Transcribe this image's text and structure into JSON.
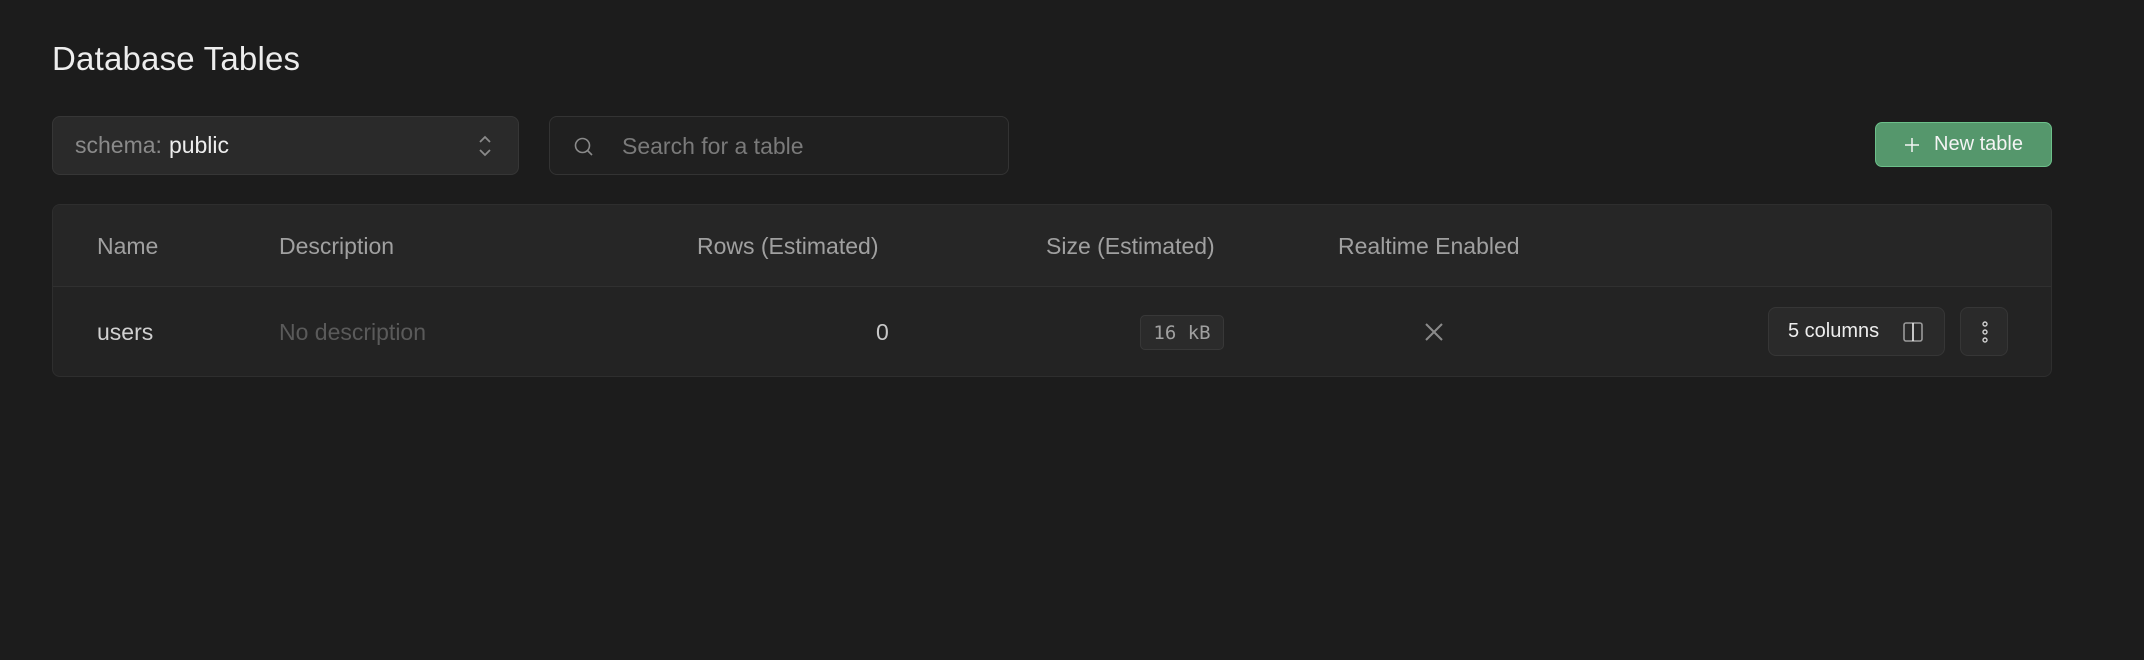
{
  "page": {
    "title": "Database Tables"
  },
  "toolbar": {
    "schema_prefix": "schema:",
    "schema_value": "public",
    "search_placeholder": "Search for a table",
    "search_value": "",
    "new_table_label": "New table",
    "accent_color": "#55976c"
  },
  "table": {
    "columns": [
      "Name",
      "Description",
      "Rows (Estimated)",
      "Size (Estimated)",
      "Realtime Enabled"
    ],
    "rows": [
      {
        "name": "users",
        "description": "No description",
        "rows_estimated": "0",
        "size_estimated": "16 kB",
        "realtime_enabled": false,
        "realtime_icon": "x-icon",
        "columns_label": "5 columns"
      }
    ]
  },
  "icons": {
    "schema_select": "chevron-up-down-icon",
    "search": "search-icon",
    "new_table": "plus-icon",
    "columns": "columns-icon",
    "more": "more-vertical-icon"
  }
}
